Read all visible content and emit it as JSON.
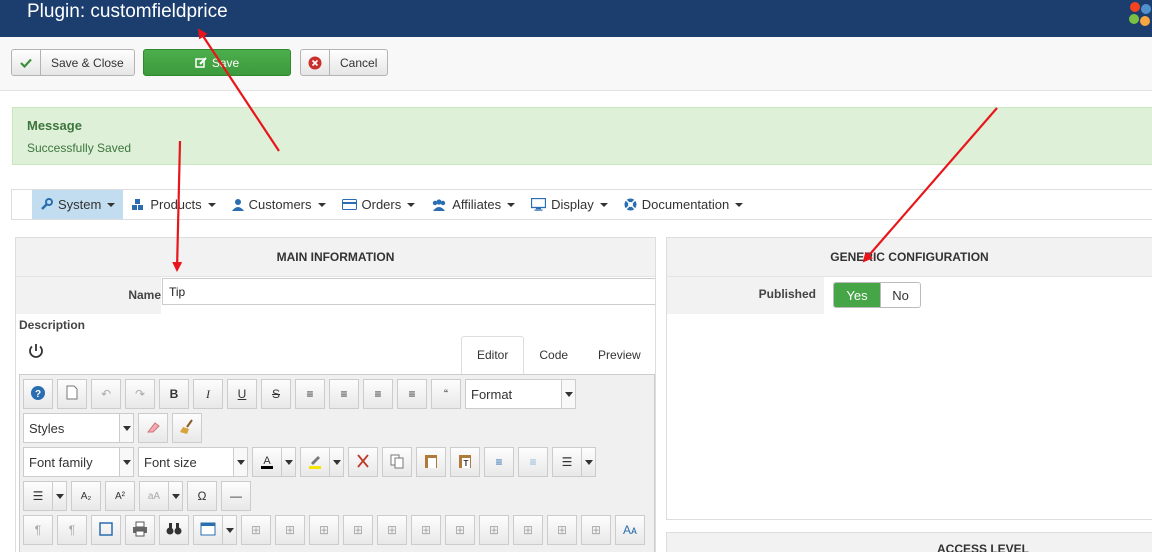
{
  "header": {
    "title": "Plugin: customfieldprice"
  },
  "toolbar": {
    "save_close": "Save & Close",
    "save": "Save",
    "cancel": "Cancel"
  },
  "alert": {
    "heading": "Message",
    "text": "Successfully Saved"
  },
  "menu": [
    {
      "label": "System",
      "icon": "wrench-icon",
      "active": true
    },
    {
      "label": "Products",
      "icon": "cubes-icon"
    },
    {
      "label": "Customers",
      "icon": "user-icon"
    },
    {
      "label": "Orders",
      "icon": "credit-card-icon"
    },
    {
      "label": "Affiliates",
      "icon": "users-icon"
    },
    {
      "label": "Display",
      "icon": "monitor-icon"
    },
    {
      "label": "Documentation",
      "icon": "life-ring-icon"
    }
  ],
  "main": {
    "title": "MAIN INFORMATION",
    "name_label": "Name",
    "name_value": "Tip",
    "description_label": "Description",
    "tabs": [
      "Editor",
      "Code",
      "Preview"
    ]
  },
  "editor": {
    "format": "Format",
    "styles": "Styles",
    "font_family": "Font family",
    "font_size": "Font size"
  },
  "generic": {
    "title": "GENERIC CONFIGURATION",
    "published_label": "Published",
    "yes": "Yes",
    "no": "No"
  },
  "access": {
    "title": "ACCESS LEVEL"
  },
  "colors": {
    "header": "#1b3e6f",
    "save": "#46a546",
    "alert_bg": "#dff0d8",
    "alert_text": "#3c763d",
    "arrow": "#e8161a"
  }
}
